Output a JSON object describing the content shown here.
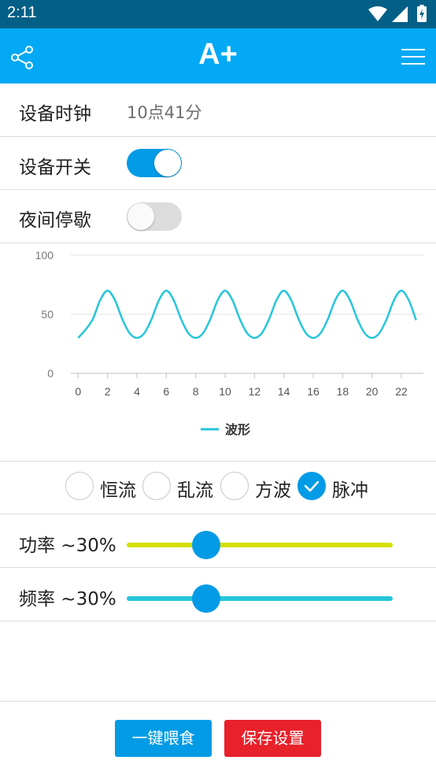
{
  "status_bar": {
    "time": "2:11"
  },
  "app_bar": {
    "title": "A+",
    "share_icon": "share-icon",
    "menu_icon": "menu-icon"
  },
  "device_clock": {
    "label": "设备时钟",
    "value": "10点41分"
  },
  "device_switch": {
    "label": "设备开关",
    "on": true
  },
  "night_pause": {
    "label": "夜间停歇",
    "on": false
  },
  "chart_data": {
    "type": "line",
    "x_ticks": [
      0,
      2,
      4,
      6,
      8,
      10,
      12,
      14,
      16,
      18,
      20,
      22
    ],
    "y_ticks": [
      0,
      50,
      100
    ],
    "xlim": [
      -0.5,
      23.5
    ],
    "ylim": [
      0,
      100
    ],
    "grid": true,
    "legend_position": "bottom",
    "series": [
      {
        "name": "波形",
        "color": "#26c6da",
        "x": [
          0,
          0.5,
          1,
          1.5,
          2,
          2.5,
          3,
          3.5,
          4,
          4.5,
          5,
          5.5,
          6,
          6.5,
          7,
          7.5,
          8,
          8.5,
          9,
          9.5,
          10,
          10.5,
          11,
          11.5,
          12,
          12.5,
          13,
          13.5,
          14,
          14.5,
          15,
          15.5,
          16,
          16.5,
          17,
          17.5,
          18,
          18.5,
          19,
          19.5,
          20,
          20.5,
          21,
          21.5,
          22,
          22.5,
          23
        ],
        "y": [
          30,
          37,
          46,
          62,
          70,
          62,
          46,
          34,
          30,
          34,
          46,
          62,
          70,
          62,
          46,
          34,
          30,
          34,
          46,
          62,
          70,
          62,
          46,
          34,
          30,
          34,
          46,
          62,
          70,
          62,
          46,
          34,
          30,
          34,
          46,
          62,
          70,
          62,
          46,
          34,
          30,
          34,
          46,
          62,
          70,
          62,
          45
        ]
      }
    ]
  },
  "modes": {
    "options": [
      {
        "label": "恒流",
        "checked": false
      },
      {
        "label": "乱流",
        "checked": false
      },
      {
        "label": "方波",
        "checked": false
      },
      {
        "label": "脉冲",
        "checked": true
      }
    ],
    "check_icon": "check-icon"
  },
  "power": {
    "label": "功率 ~30%",
    "percent": 30,
    "color": "#d4e000",
    "thumb_color": "#039be5"
  },
  "frequency": {
    "label": "频率 ~30%",
    "percent": 30,
    "color": "#26c6da",
    "thumb_color": "#039be5"
  },
  "buttons": {
    "feed": "一键喂食",
    "save": "保存设置"
  },
  "colors": {
    "primary": "#03a9f4",
    "status_bar": "#035f86",
    "accent": "#039be5",
    "danger": "#e8212b"
  }
}
